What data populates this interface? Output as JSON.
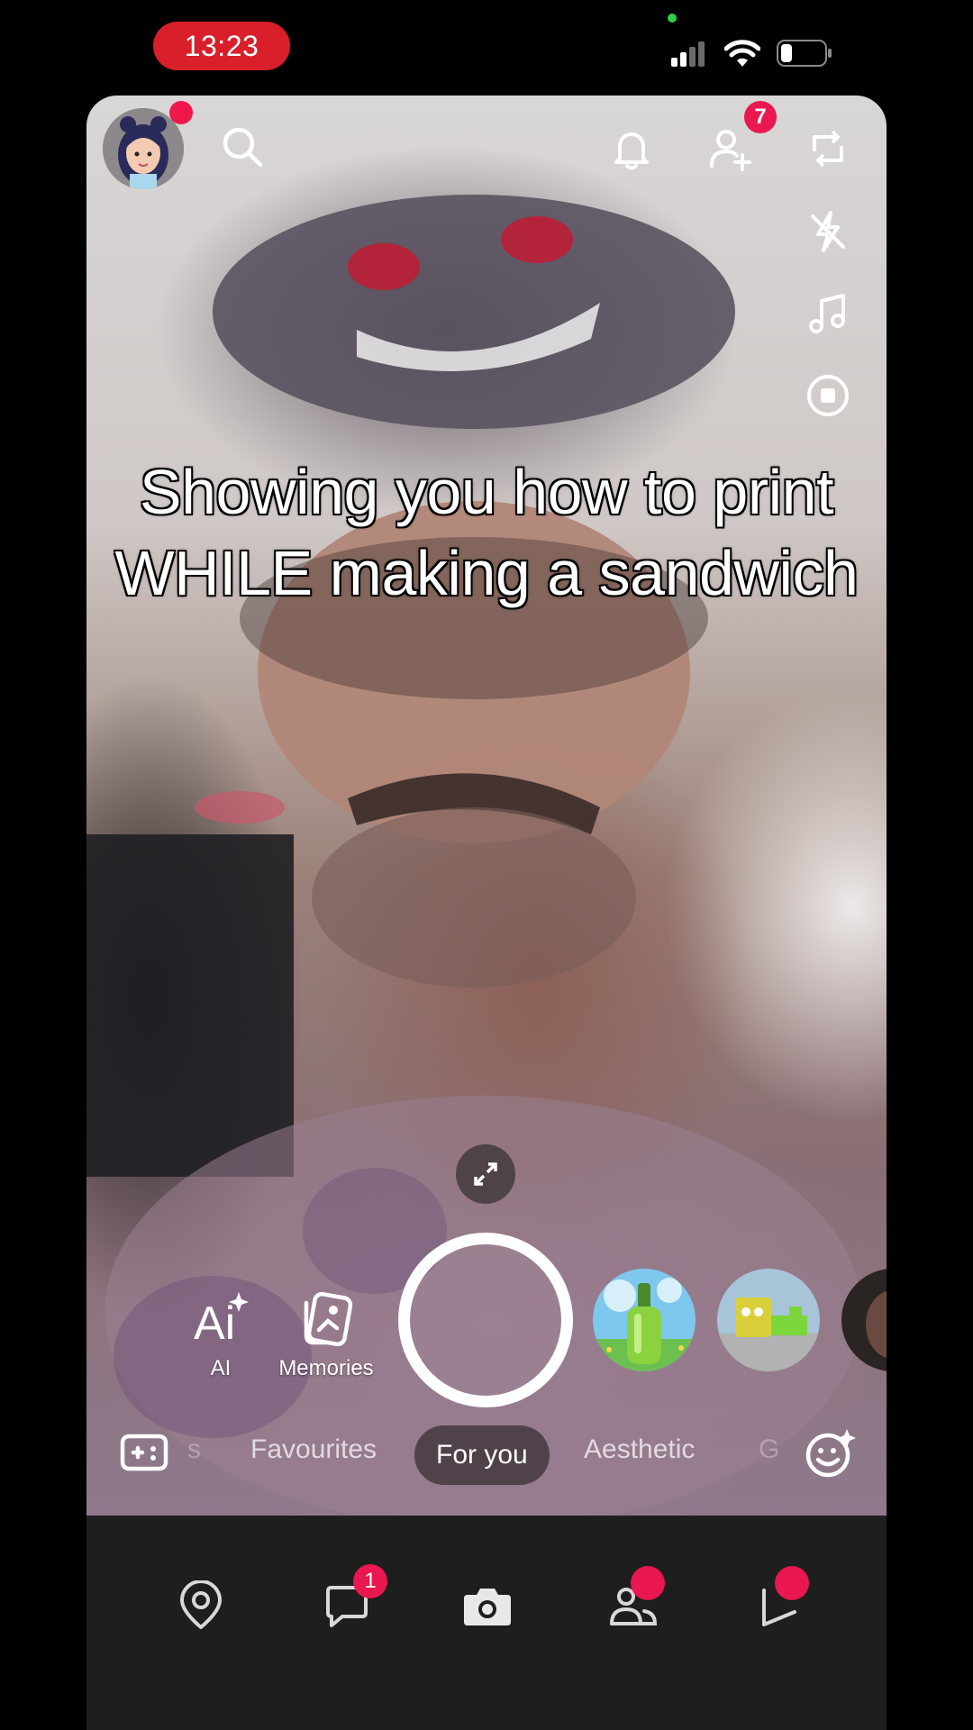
{
  "status_bar": {
    "time": "13:23"
  },
  "camera": {
    "caption_line1": "Showing you how to print",
    "caption_line2": "WHILE making a sandwich"
  },
  "top_bar": {
    "add_friends_badge": "7"
  },
  "right_tools": [
    "flip-camera-icon",
    "flash-off-icon",
    "music-note-icon",
    "timer-icon"
  ],
  "capture": {
    "ai_label": "AI",
    "memories_label": "Memories"
  },
  "lens_tabs": {
    "items": [
      "s",
      "Favourites",
      "For you",
      "Aesthetic",
      "G"
    ],
    "active": "For you"
  },
  "bottom_nav": {
    "chat_badge": "1"
  },
  "colors": {
    "accent_red": "#ea1750",
    "time_pill": "#d81f2a",
    "nav_background": "#1e1e1e"
  }
}
